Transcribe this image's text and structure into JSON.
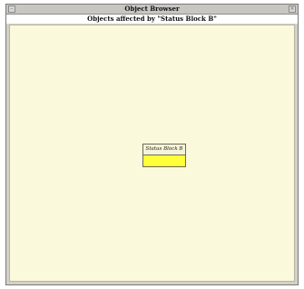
{
  "window": {
    "title": "Object Browser",
    "subtitle": "Objects affected by \"Status Block B\"",
    "controls": {
      "left_icon": "window-menu-icon",
      "right_icon": "close-icon"
    }
  },
  "canvas": {
    "background_color": "#fbf9dc",
    "nodes": [
      {
        "label": "Status Block B",
        "fill_color": "#ffff3a"
      }
    ]
  }
}
